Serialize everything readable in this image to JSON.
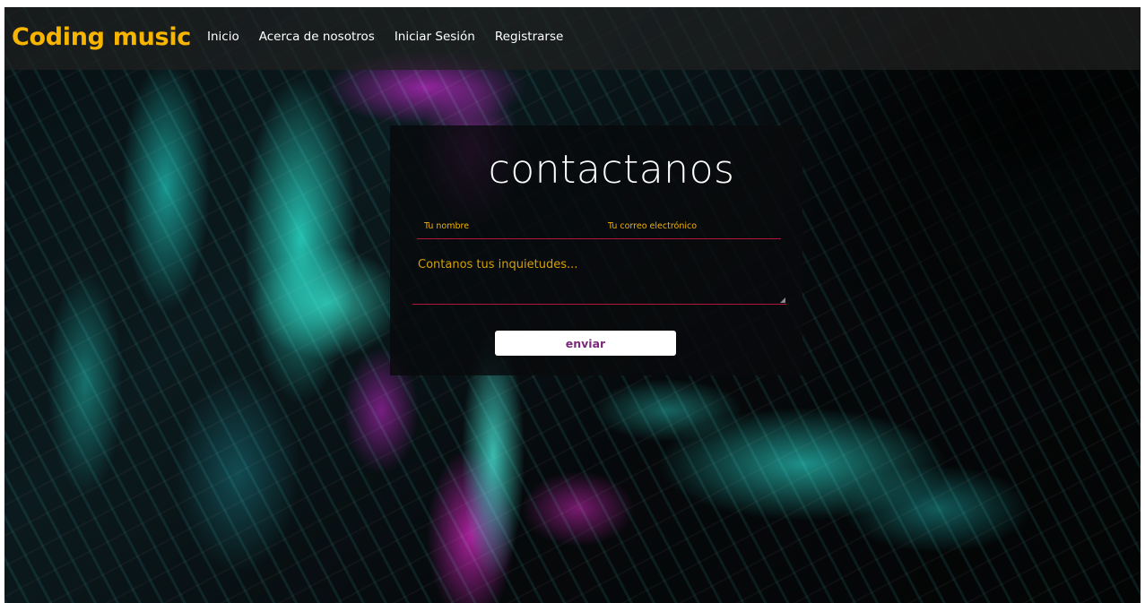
{
  "navbar": {
    "brand": "Coding music",
    "links": [
      {
        "label": "Inicio"
      },
      {
        "label": "Acerca de nosotros"
      },
      {
        "label": "Iniciar Sesión"
      },
      {
        "label": "Registrarse"
      }
    ]
  },
  "contact": {
    "title": "contactanos",
    "name_label": "Tu nombre",
    "email_label": "Tu correo electrónico",
    "message_placeholder": "Contanos tus inquietudes...",
    "submit_label": "enviar"
  },
  "colors": {
    "brand": "#f7b500",
    "field_label": "#f0b300",
    "underline": "#b0173b",
    "button_text": "#7a2a7a",
    "navbar_bg": "#202020"
  },
  "icons": {
    "textarea_resize": "resize-grip-icon"
  }
}
